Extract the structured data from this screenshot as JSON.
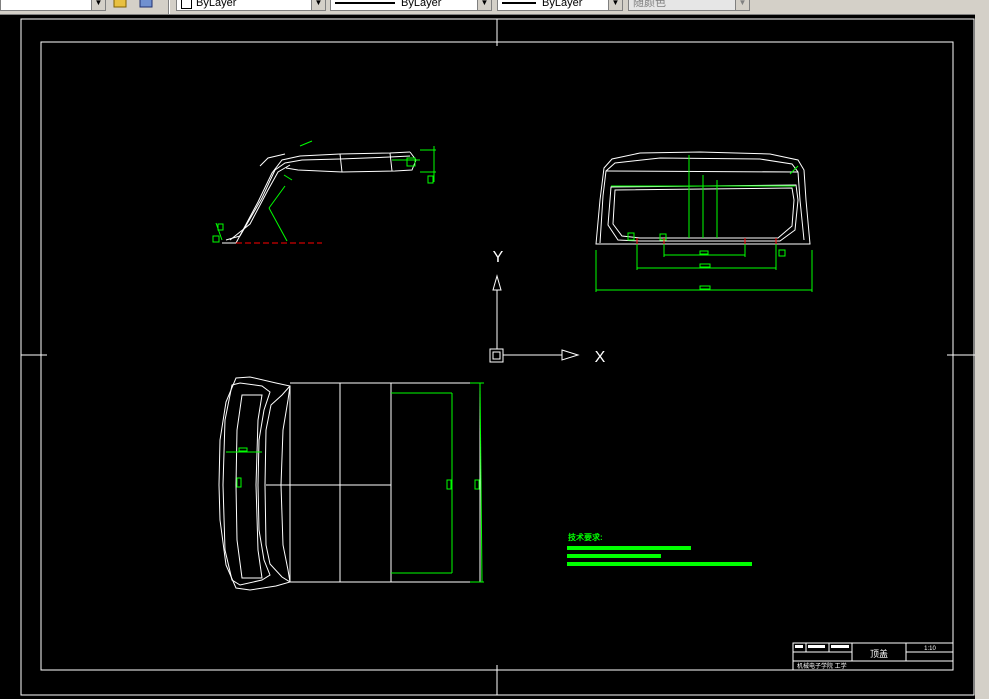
{
  "toolbar": {
    "layer_combo": "ByLayer",
    "linetype_combo": "ByLayer",
    "lineweight_combo": "ByLayer",
    "plotstyle_combo": "随颜色"
  },
  "ucs": {
    "x_label": "X",
    "y_label": "Y"
  },
  "drawing": {
    "tech_req_title": "技术要求:",
    "views": [
      "side-view",
      "front-view",
      "top-view"
    ]
  },
  "title_block": {
    "part_name": "顶盖",
    "scale": "1:10",
    "school": "机械电子学院 工学"
  },
  "colors": {
    "background": "#000000",
    "geometry": "#ffffff",
    "dimensions": "#00ff00",
    "centerline": "#ff0000",
    "toolbar": "#d4d0c8"
  }
}
